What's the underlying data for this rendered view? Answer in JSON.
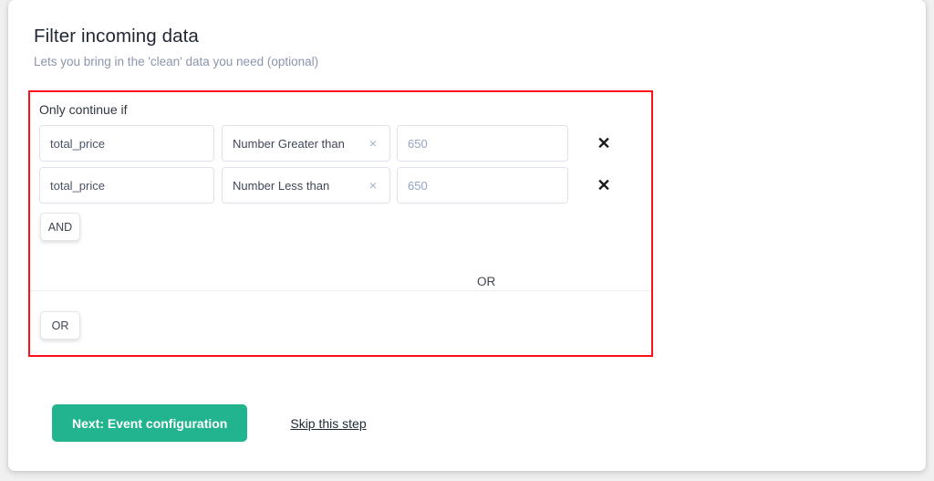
{
  "header": {
    "title": "Filter incoming data",
    "subtitle": "Lets you bring in the 'clean' data you need (optional)"
  },
  "filter_panel": {
    "label": "Only continue if",
    "conditions": [
      {
        "field": "total_price",
        "operator": "Number Greater than",
        "operator_clear_icon": "close-small-icon",
        "value": "650",
        "remove_icon": "close-icon"
      },
      {
        "field": "total_price",
        "operator": "Number Less than",
        "operator_clear_icon": "close-small-icon",
        "value": "650",
        "remove_icon": "close-icon"
      }
    ],
    "and_button": "AND",
    "divider_label": "OR",
    "or_button": "OR",
    "highlight_color": "#ff0f17"
  },
  "footer": {
    "next_button": "Next: Event configuration",
    "skip_link": "Skip this step",
    "primary_color": "#21b48e"
  }
}
